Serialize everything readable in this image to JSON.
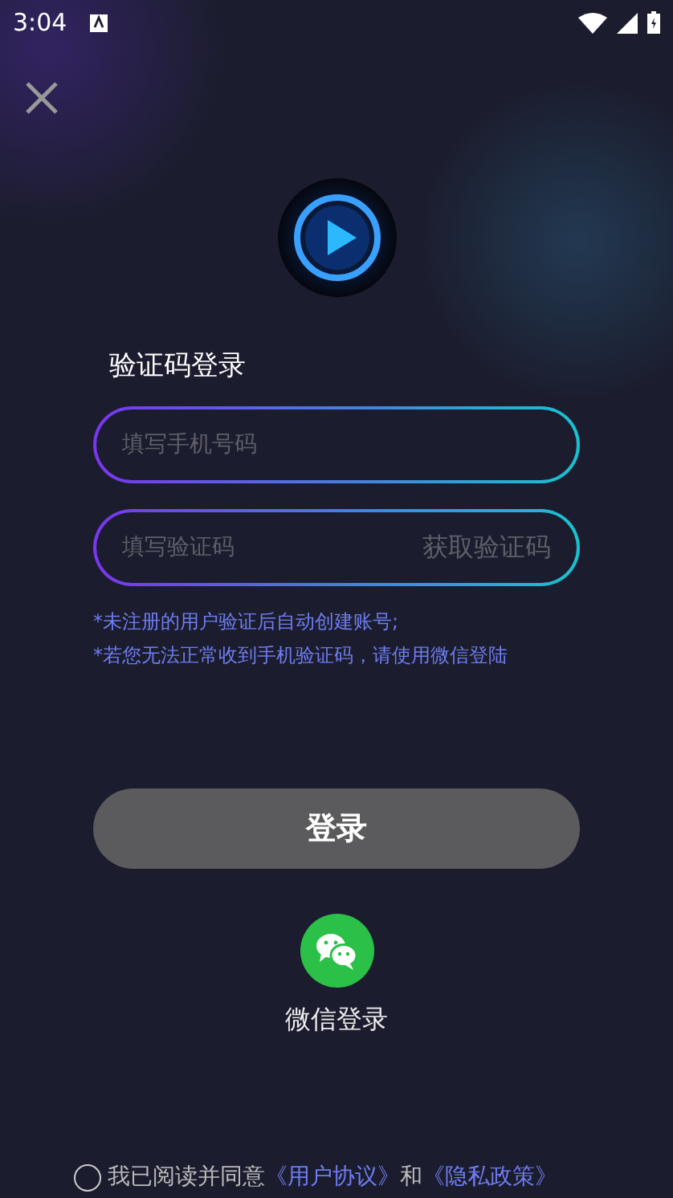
{
  "status_bar": {
    "time": "3:04"
  },
  "title": "验证码登录",
  "phone_field": {
    "placeholder": "填写手机号码"
  },
  "code_field": {
    "placeholder": "填写验证码",
    "action": "获取验证码"
  },
  "notes": [
    "*未注册的用户验证后自动创建账号;",
    "*若您无法正常收到手机验证码，请使用微信登陆"
  ],
  "login_button": {
    "label": "登录",
    "disabled": true
  },
  "wechat_login": {
    "label": "微信登录"
  },
  "agreement": {
    "checked": false,
    "prefix": "我已阅读并同意",
    "links": [
      "《用户协议》",
      "《隐私政策》"
    ],
    "joiner": "和"
  }
}
